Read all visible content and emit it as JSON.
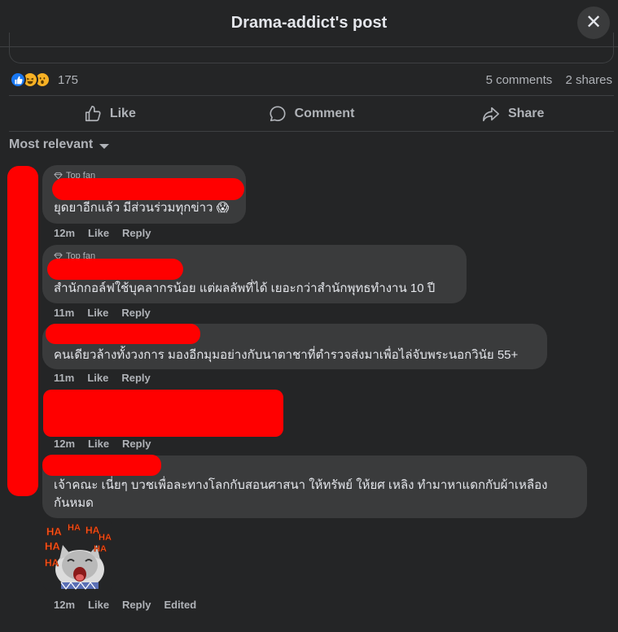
{
  "header": {
    "title": "Drama-addict's post",
    "close_icon": "close-icon"
  },
  "stats": {
    "reaction_icons": [
      "like-icon",
      "haha-icon",
      "wow-icon"
    ],
    "reaction_count": "175",
    "comments": "5 comments",
    "shares": "2 shares"
  },
  "actions": {
    "like": "Like",
    "comment": "Comment",
    "share": "Share"
  },
  "sort": {
    "label": "Most relevant"
  },
  "comments": [
    {
      "badge": "Top fan",
      "text": "ยุดยาอีกแล้ว มีส่วนร่วมทุกข่าว 😱",
      "time": "12m",
      "like": "Like",
      "reply": "Reply"
    },
    {
      "badge": "Top fan",
      "text": "สำนักกอล์ฟใช้บุคลากรน้อย แต่ผลลัพที่ได้ เยอะกว่าสำนักพุทธทำงาน 10 ปี",
      "time": "11m",
      "like": "Like",
      "reply": "Reply"
    },
    {
      "text": "คนเดียวล้างทั้งวงการ มองอีกมุมอย่างกับนาตาชาที่ตำรวจส่งมาเพื่อไล่จับพระนอกวินัย 55+",
      "time": "11m",
      "like": "Like",
      "reply": "Reply"
    },
    {
      "time": "12m",
      "like": "Like",
      "reply": "Reply"
    },
    {
      "text_line1": "เจ้าคณะ เนี่ยๆ บวชเพื่อละทางโลกกับสอนศาสนา ให้ทรัพย์ ให้ยศ เหลิง ทำมาหาแดกกับผ้าเหลือง",
      "text_line2": "กันหมด",
      "time": "12m",
      "like": "Like",
      "reply": "Reply",
      "edited": "Edited"
    }
  ],
  "sticker": {
    "text": "HA"
  },
  "colors": {
    "background": "#242526",
    "bubble": "#3a3b3c",
    "redaction": "#ff0000",
    "like_blue": "#1877f2"
  }
}
